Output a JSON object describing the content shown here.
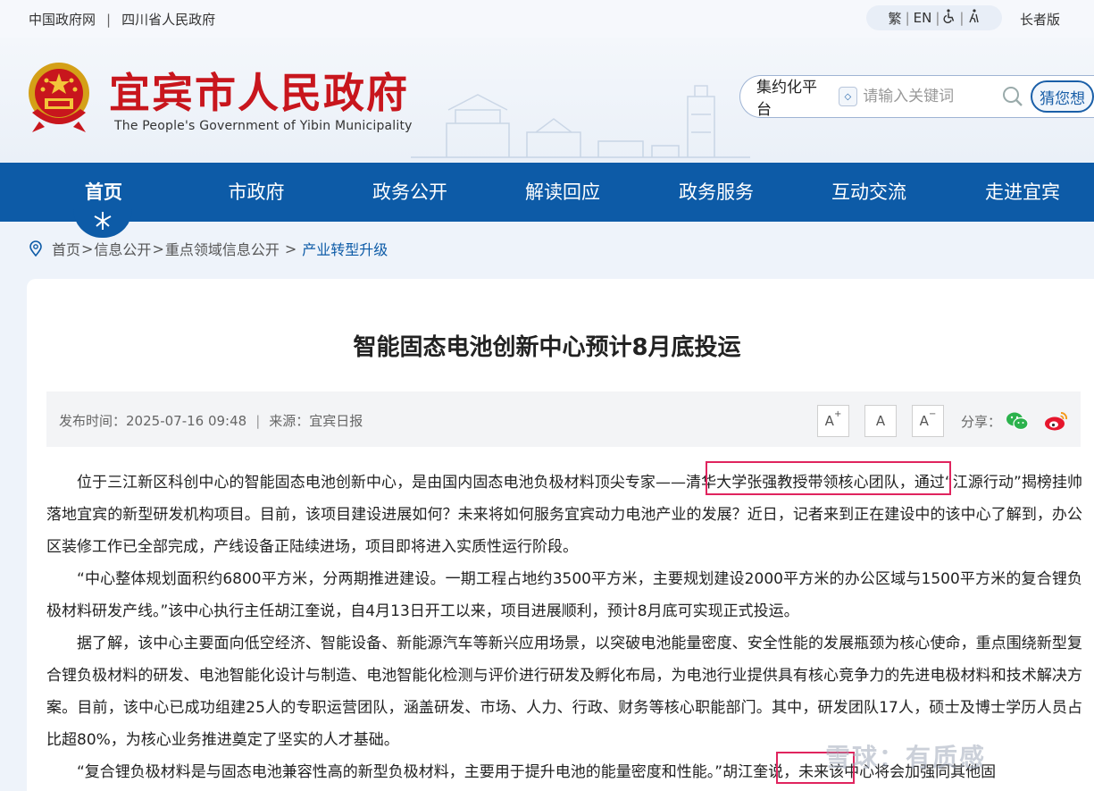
{
  "topbar": {
    "links": [
      "中国政府网",
      "四川省人民政府"
    ],
    "separator": "|",
    "tools": {
      "traditional": "繁",
      "english": "EN",
      "accessibility_icon": "wheelchair-icon",
      "elder_icon": "elder-icon"
    },
    "elder_mode": "长者版"
  },
  "header": {
    "title": "宜宾市人民政府",
    "subtitle": "The People's Government of Yibin Municipality",
    "search": {
      "scope": "集约化平台",
      "placeholder": "请输入关键词",
      "guess_button": "猜您想"
    }
  },
  "nav": {
    "items": [
      "首页",
      "市政府",
      "政务公开",
      "解读回应",
      "政务服务",
      "互动交流",
      "走进宜宾"
    ],
    "active_index": 0
  },
  "breadcrumb": {
    "items": [
      "首页",
      "信息公开",
      "重点领域信息公开"
    ],
    "current": "产业转型升级",
    "separator": ">"
  },
  "article": {
    "title": "智能固态电池创新中心预计8月底投运",
    "publish_label": "发布时间：",
    "publish_time": "2025-07-16 09:48",
    "source_label": "来源：",
    "source": "宜宾日报",
    "font_buttons": [
      "A",
      "A",
      "A"
    ],
    "font_button_marks": [
      "+",
      "",
      "−"
    ],
    "share_label": "分享：",
    "paragraphs": [
      {
        "before": "位于三江新区科创中心的智能固态电池创新中心，是由国内固态电池负极材料顶尖专家——",
        "highlight": "清华大学张强教授带领核心团队",
        "after": "，通过“江源行动”揭榜挂帅落地宜宾的新型研发机构项目。目前，该项目建设进展如何？未来将如何服务宜宾动力电池产业的发展？近日，记者来到正在建设中的该中心了解到，办公区装修工作已全部完成，产线设备正陆续进场，项目即将进入实质性运行阶段。"
      },
      {
        "text": "“中心整体规划面积约6800平方米，分两期推进建设。一期工程占地约3500平方米，主要规划建设2000平方米的办公区域与1500平方米的复合锂负极材料研发产线。”该中心执行主任胡江奎说，自4月13日开工以来，项目进展顺利，预计8月底可实现正式投运。"
      },
      {
        "text": "据了解，该中心主要面向低空经济、智能设备、新能源汽车等新兴应用场景，以突破电池能量密度、安全性能的发展瓶颈为核心使命，重点围绕新型复合锂负极材料的研发、电池智能化设计与制造、电池智能化检测与评价进行研发及孵化布局，为电池行业提供具有核心竞争力的先进电极材料和技术解决方案。目前，该中心已成功组建25人的专职运营团队，涵盖研发、市场、人力、行政、财务等核心职能部门。其中，研发团队17人，硕士及博士学历人员占比超80%，为核心业务推进奠定了坚实的人才基础。"
      },
      {
        "before": "“复合锂负极材料是与固态电池兼容性高的新型负极材料，主要用于提升电池的能量密度和性能。”",
        "highlight": "胡江奎说",
        "after": "，未来该中心将会加强同其他固"
      }
    ]
  },
  "watermark": "雪球：有质感",
  "colors": {
    "brand_red": "#c8161d",
    "nav_blue": "#0d5ba7",
    "highlight_border": "#e0245e"
  }
}
